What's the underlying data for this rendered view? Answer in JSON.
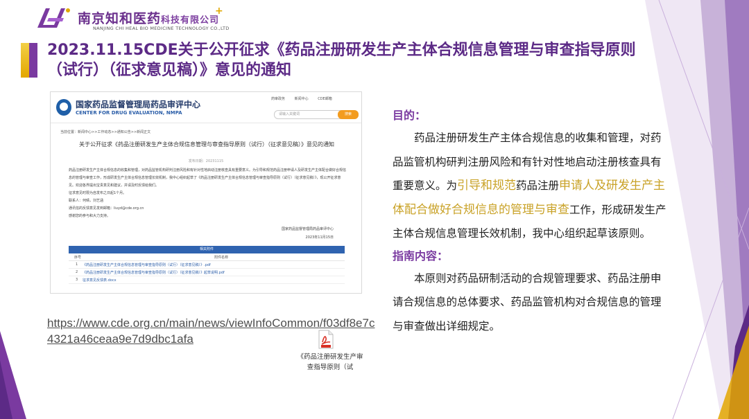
{
  "logo": {
    "name_main": "南京知和医药",
    "name_suffix": "科技有限公司",
    "plus": "+",
    "name_en": "NANJING CHI HEAL BIO MEDICINE TECHNOLOGY CO.,LTD"
  },
  "title": "2023.11.15CDE关于公开征求《药品注册研发生产主体合规信息管理与审查指导原则（试行）（征求意见稿）》意见的通知",
  "screenshot": {
    "site_name_cn": "国家药品监督管理局药品审评中心",
    "site_name_en": "CENTER FOR DRUG EVALUATION, NMPA",
    "top_nav": [
      "药审政务",
      "新闻中心",
      "CDE邮箱"
    ],
    "search_placeholder": "请输入关键词",
    "search_button": "搜索",
    "breadcrumb": "当前位置：新闻中心>>工作动态>>通知公告>>新闻正文",
    "article_title": "关于公开征求《药品注册研发生产主体合规信息管理与审查指导原则（试行）（征求意见稿）》意见的通知",
    "publish_date": "发布日期：20231115",
    "body_paragraphs": [
      "药品注册研发生产主体合规信息的收集和管理，对药品监管机构研判注册风险和有针对性地启动注册核查具有重要意义。为引导和规范药品注册申请人及研发生产主体配合做好合规信息的管理与审查工作，形成研发生产主体合规信息管理长效机制，我中心组织起草了《药品注册研发生产主体合规信息管理与审查指导原则（试行）（征求意见稿）》，现公开征求意见。欢迎各界提出宝贵意见和建议，并请及时反馈给我们。",
      "征求意见时限为自发布之日起1个月。",
      "联系人：何晴，刘艺涵",
      "通讯信的反馈意见发到邮箱：liuyd@cde.org.cn",
      "感谢您的参与和大力支持。"
    ],
    "signature_org": "国家药品监督管理局药品审评中心",
    "signature_date": "2023年11月15日",
    "attachments": {
      "header": "相关附件",
      "col_no": "序号",
      "col_name": "附件名称",
      "rows": [
        {
          "no": "1",
          "name": "《药品注册研发生产主体合规信息管理与审查指导原则（试行）（征求意见稿）》.pdf"
        },
        {
          "no": "2",
          "name": "《药品注册研发生产主体合规信息管理与审查指导原则（试行）（征求意见稿）》起草说明.pdf"
        },
        {
          "no": "3",
          "name": "征求意见反馈表.docx"
        }
      ]
    }
  },
  "link": "https://www.cde.org.cn/main/news/viewInfoCommon/f03df8e7c4321a46ceaa9e7d9dbc1afa",
  "pdf_caption": "《药品注册研发生产审查指导原则（试",
  "right": {
    "purpose_heading": "目的：",
    "purpose_part1": "药品注册研发生产主体合规信息的收集和管理，对药品监管机构研判注册风险和有针对性地启动注册核查具有重要意义。为",
    "purpose_hl1": "引导和规范",
    "purpose_part2": "药品注册",
    "purpose_hl2": "申请人及研发生产主体配合做好合规信息的管理与审查",
    "purpose_part3": "工作，形成研发生产主体合规信息管理长效机制，我中心组织起草该原则。",
    "content_heading": "指南内容：",
    "content_text": "本原则对药品研制活动的合规管理要求、药品注册申请合规信息的总体要求、药品监管机构对合规信息的管理与审查做出详细规定。"
  }
}
